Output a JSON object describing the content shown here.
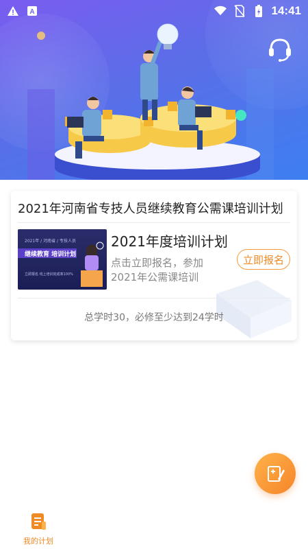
{
  "status_bar": {
    "time": "14:41",
    "icons": [
      "warning-icon",
      "a-icon",
      "wifi-icon",
      "no-sim-icon",
      "battery-charging-icon"
    ]
  },
  "header": {
    "support_icon": "headset-icon"
  },
  "plan_card": {
    "title": "2021年河南省专技人员继续教育公需课培训计划",
    "thumbnail": {
      "small_text": "2021年 / 河南省 / 专技人员",
      "banner_text": "继续教育  培训计划",
      "footer_text": "立即报名    线上培训完成率100%"
    },
    "plan_name": "2021年度培训计划",
    "description": "点击立即报名，参加2021年公需课培训",
    "enroll_button": "立即报名",
    "summary": "总学时30，必修至少达到24学时"
  },
  "fab": {
    "icon": "edit-note-icon"
  },
  "bottom_nav": {
    "items": [
      {
        "label": "我的计划",
        "icon": "plan-document-icon",
        "active": true
      }
    ]
  },
  "colors": {
    "hero_start": "#7a5cf0",
    "hero_end": "#3d7ff0",
    "accent_orange": "#f08a24",
    "gear_yellow": "#f7c948"
  }
}
